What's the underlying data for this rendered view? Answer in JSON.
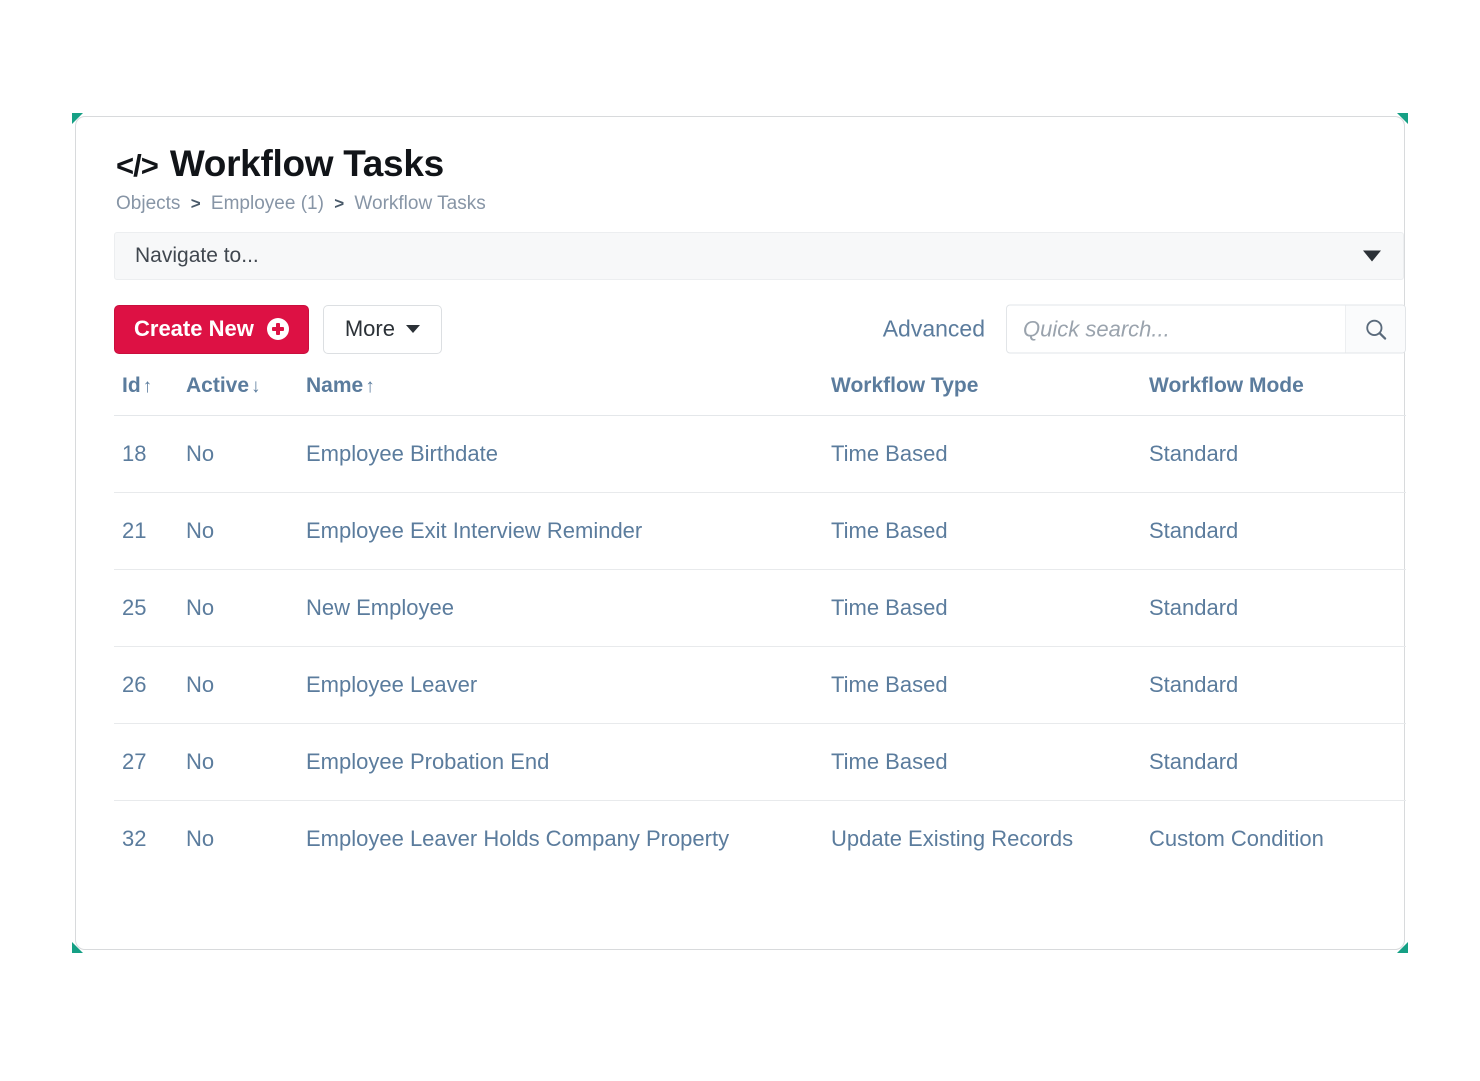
{
  "header": {
    "icon": "code-brackets-icon",
    "title": "Workflow Tasks"
  },
  "breadcrumb": {
    "items": [
      "Objects",
      "Employee (1)",
      "Workflow Tasks"
    ],
    "separator": ">"
  },
  "navigate": {
    "label": "Navigate to...",
    "caret": "chevron-down-icon"
  },
  "toolbar": {
    "create_label": "Create New",
    "create_icon": "plus-circle-icon",
    "more_label": "More",
    "more_caret": "caret-down-icon",
    "advanced_label": "Advanced",
    "search_placeholder": "Quick search...",
    "search_value": "",
    "search_icon": "magnifier-icon"
  },
  "table": {
    "columns": [
      {
        "label": "Id",
        "sort": "↑"
      },
      {
        "label": "Active",
        "sort": "↓"
      },
      {
        "label": "Name",
        "sort": "↑"
      },
      {
        "label": "Workflow Type",
        "sort": ""
      },
      {
        "label": "Workflow Mode",
        "sort": ""
      }
    ],
    "rows": [
      {
        "id": "18",
        "active": "No",
        "name": "Employee Birthdate",
        "type": "Time Based",
        "mode": "Standard"
      },
      {
        "id": "21",
        "active": "No",
        "name": "Employee Exit Interview Reminder",
        "type": "Time Based",
        "mode": "Standard"
      },
      {
        "id": "25",
        "active": "No",
        "name": "New Employee",
        "type": "Time Based",
        "mode": "Standard"
      },
      {
        "id": "26",
        "active": "No",
        "name": "Employee Leaver",
        "type": "Time Based",
        "mode": "Standard"
      },
      {
        "id": "27",
        "active": "No",
        "name": "Employee Probation End",
        "type": "Time Based",
        "mode": "Standard"
      },
      {
        "id": "32",
        "active": "No",
        "name": "Employee Leaver Holds Company Property",
        "type": "Update Existing Records",
        "mode": "Custom Condition"
      }
    ]
  },
  "colors": {
    "primary": "#dd1144",
    "link": "#5b7c9d",
    "accent_corner": "#16a085",
    "muted": "#8795a6"
  }
}
